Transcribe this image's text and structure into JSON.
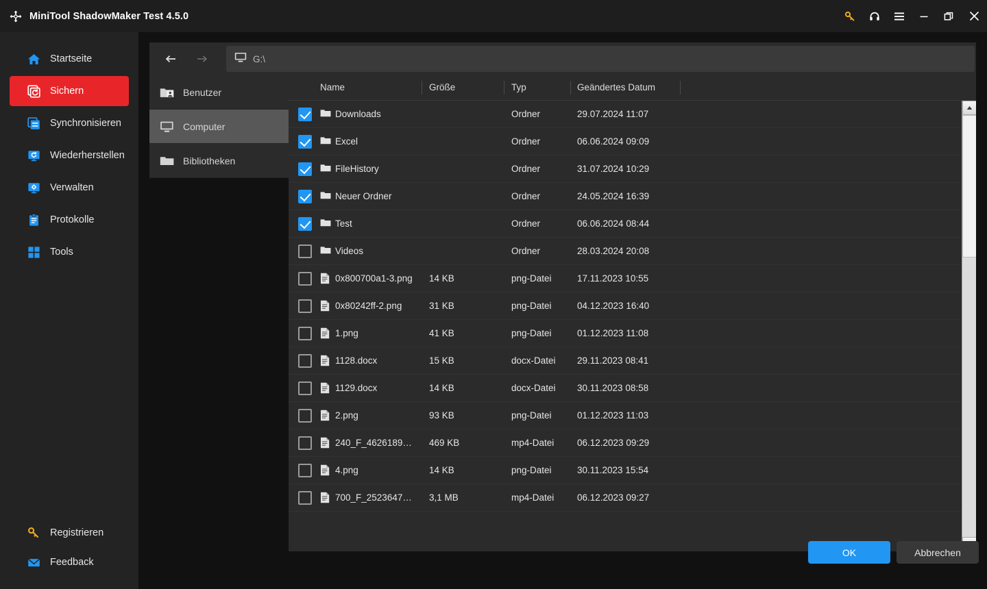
{
  "window": {
    "title": "MiniTool ShadowMaker Test 4.5.0",
    "logo_icon": "shadowmaker-logo-icon",
    "controls": [
      {
        "name": "license-key-icon",
        "glyph": "key",
        "color": "#f0a91e"
      },
      {
        "name": "support-headset-icon",
        "glyph": "headset",
        "color": "#ffffff"
      },
      {
        "name": "menu-icon",
        "glyph": "hamburger",
        "color": "#ffffff"
      },
      {
        "name": "minimize-button",
        "glyph": "minimize",
        "color": "#ffffff"
      },
      {
        "name": "maximize-button",
        "glyph": "maximize",
        "color": "#ffffff"
      },
      {
        "name": "close-button",
        "glyph": "close",
        "color": "#ffffff"
      }
    ]
  },
  "sidebar": {
    "accent_color": "#e8262a",
    "items": [
      {
        "label": "Startseite",
        "icon": "home-icon",
        "active": false
      },
      {
        "label": "Sichern",
        "icon": "backup-icon",
        "active": true
      },
      {
        "label": "Synchronisieren",
        "icon": "sync-icon",
        "active": false
      },
      {
        "label": "Wiederherstellen",
        "icon": "restore-icon",
        "active": false
      },
      {
        "label": "Verwalten",
        "icon": "manage-icon",
        "active": false
      },
      {
        "label": "Protokolle",
        "icon": "logs-icon",
        "active": false
      },
      {
        "label": "Tools",
        "icon": "tools-icon",
        "active": false
      }
    ],
    "bottom_items": [
      {
        "label": "Registrieren",
        "icon": "key-icon"
      },
      {
        "label": "Feedback",
        "icon": "mail-icon"
      }
    ]
  },
  "pathbar": {
    "back_icon": "arrow-left-icon",
    "forward_icon": "arrow-right-icon",
    "location_icon": "computer-monitor-icon",
    "path": "G:\\"
  },
  "tree": {
    "items": [
      {
        "label": "Benutzer",
        "icon": "users-folder-icon",
        "selected": false
      },
      {
        "label": "Computer",
        "icon": "computer-monitor-icon",
        "selected": true
      },
      {
        "label": "Bibliotheken",
        "icon": "folder-icon",
        "selected": false
      }
    ]
  },
  "filelist": {
    "columns": [
      "Name",
      "Größe",
      "Typ",
      "Geändertes Datum"
    ],
    "rows": [
      {
        "checked": true,
        "icon": "folder-icon",
        "name": "Downloads",
        "size": "",
        "type": "Ordner",
        "date": "29.07.2024 11:07"
      },
      {
        "checked": true,
        "icon": "folder-icon",
        "name": "Excel",
        "size": "",
        "type": "Ordner",
        "date": "06.06.2024 09:09"
      },
      {
        "checked": true,
        "icon": "folder-icon",
        "name": "FileHistory",
        "size": "",
        "type": "Ordner",
        "date": "31.07.2024 10:29"
      },
      {
        "checked": true,
        "icon": "folder-icon",
        "name": "Neuer Ordner",
        "size": "",
        "type": "Ordner",
        "date": "24.05.2024 16:39"
      },
      {
        "checked": true,
        "icon": "folder-icon",
        "name": "Test",
        "size": "",
        "type": "Ordner",
        "date": "06.06.2024 08:44"
      },
      {
        "checked": false,
        "icon": "folder-icon",
        "name": "Videos",
        "size": "",
        "type": "Ordner",
        "date": "28.03.2024 20:08"
      },
      {
        "checked": false,
        "icon": "document-icon",
        "name": "0x800700a1-3.png",
        "size": "14 KB",
        "type": "png-Datei",
        "date": "17.11.2023 10:55"
      },
      {
        "checked": false,
        "icon": "document-icon",
        "name": "0x80242ff-2.png",
        "size": "31 KB",
        "type": "png-Datei",
        "date": "04.12.2023 16:40"
      },
      {
        "checked": false,
        "icon": "document-icon",
        "name": "1.png",
        "size": "41 KB",
        "type": "png-Datei",
        "date": "01.12.2023 11:08"
      },
      {
        "checked": false,
        "icon": "document-icon",
        "name": "1128.docx",
        "size": "15 KB",
        "type": "docx-Datei",
        "date": "29.11.2023 08:41"
      },
      {
        "checked": false,
        "icon": "document-icon",
        "name": "1129.docx",
        "size": "14 KB",
        "type": "docx-Datei",
        "date": "30.11.2023 08:58"
      },
      {
        "checked": false,
        "icon": "document-icon",
        "name": "2.png",
        "size": "93 KB",
        "type": "png-Datei",
        "date": "01.12.2023 11:03"
      },
      {
        "checked": false,
        "icon": "document-icon",
        "name": "240_F_4626189…",
        "size": "469 KB",
        "type": "mp4-Datei",
        "date": "06.12.2023 09:29"
      },
      {
        "checked": false,
        "icon": "document-icon",
        "name": "4.png",
        "size": "14 KB",
        "type": "png-Datei",
        "date": "30.11.2023 15:54"
      },
      {
        "checked": false,
        "icon": "document-icon",
        "name": "700_F_2523647…",
        "size": "3,1 MB",
        "type": "mp4-Datei",
        "date": "06.12.2023 09:27"
      }
    ],
    "scrollbar": {
      "up_icon": "scroll-up-icon",
      "down_icon": "scroll-down-icon"
    }
  },
  "footer": {
    "ok_label": "OK",
    "cancel_label": "Abbrechen",
    "ok_color": "#2196f3"
  }
}
